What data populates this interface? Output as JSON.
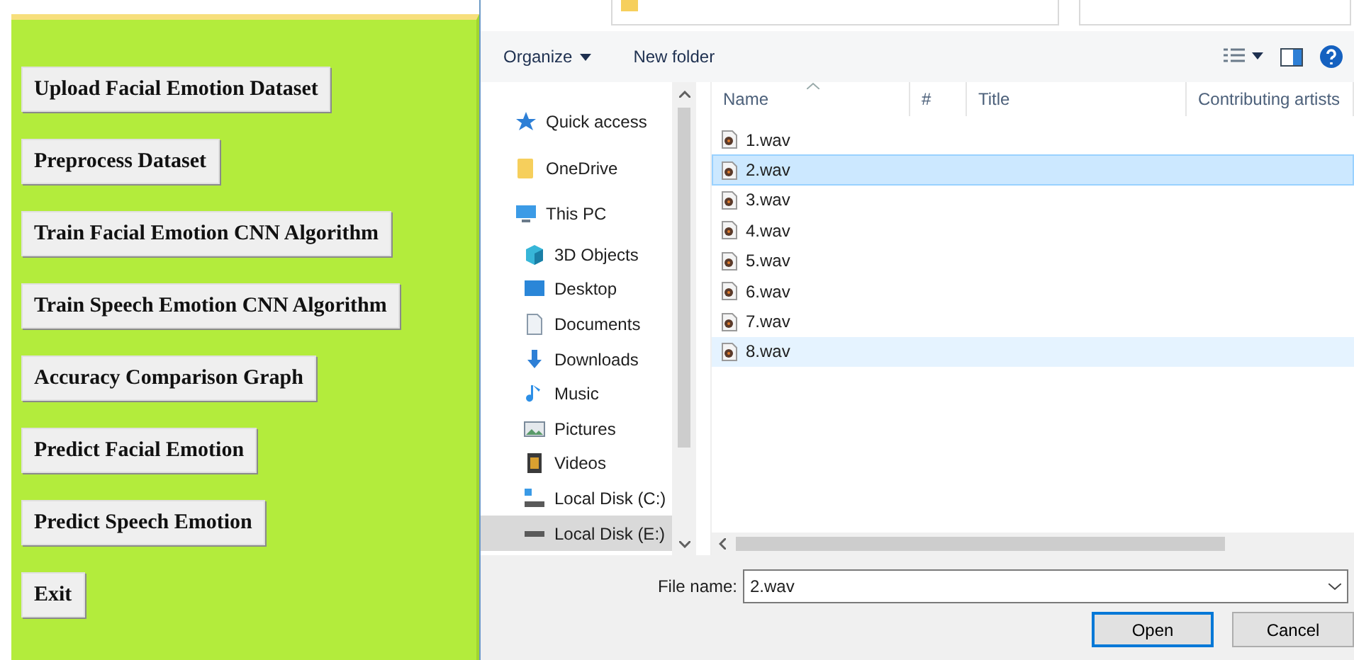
{
  "app_buttons": [
    "Upload Facial Emotion Dataset",
    "Preprocess Dataset",
    "Train Facial Emotion CNN Algorithm",
    "Train Speech Emotion CNN Algorithm",
    "Accuracy Comparison Graph",
    "Predict Facial Emotion",
    "Predict Speech Emotion",
    "Exit"
  ],
  "dialog": {
    "toolbar": {
      "organize": "Organize",
      "new_folder": "New folder"
    },
    "nav_items": [
      {
        "label": "Quick access",
        "kind": "star",
        "selected": false
      },
      {
        "label": "OneDrive",
        "kind": "folder",
        "selected": false
      },
      {
        "label": "This PC",
        "kind": "pc",
        "selected": false,
        "children": [
          {
            "label": "3D Objects",
            "kind": "cube",
            "selected": false
          },
          {
            "label": "Desktop",
            "kind": "desktop",
            "selected": false
          },
          {
            "label": "Documents",
            "kind": "document",
            "selected": false
          },
          {
            "label": "Downloads",
            "kind": "download",
            "selected": false
          },
          {
            "label": "Music",
            "kind": "music",
            "selected": false
          },
          {
            "label": "Pictures",
            "kind": "pictures",
            "selected": false
          },
          {
            "label": "Videos",
            "kind": "videos",
            "selected": false
          },
          {
            "label": "Local Disk (C:)",
            "kind": "system-disk",
            "selected": false
          },
          {
            "label": "Local Disk (E:)",
            "kind": "disk",
            "selected": true
          }
        ]
      }
    ],
    "columns": [
      "Name",
      "#",
      "Title",
      "Contributing artists"
    ],
    "files": [
      {
        "name": "1.wav",
        "selected": false,
        "hovered": false
      },
      {
        "name": "2.wav",
        "selected": true,
        "hovered": false
      },
      {
        "name": "3.wav",
        "selected": false,
        "hovered": false
      },
      {
        "name": "4.wav",
        "selected": false,
        "hovered": false
      },
      {
        "name": "5.wav",
        "selected": false,
        "hovered": false
      },
      {
        "name": "6.wav",
        "selected": false,
        "hovered": false
      },
      {
        "name": "7.wav",
        "selected": false,
        "hovered": false
      },
      {
        "name": "8.wav",
        "selected": false,
        "hovered": true
      }
    ],
    "file_name_label": "File name:",
    "file_name": "2.wav",
    "buttons": [
      {
        "label": "Open",
        "default": true
      },
      {
        "label": "Cancel",
        "default": false
      }
    ]
  }
}
